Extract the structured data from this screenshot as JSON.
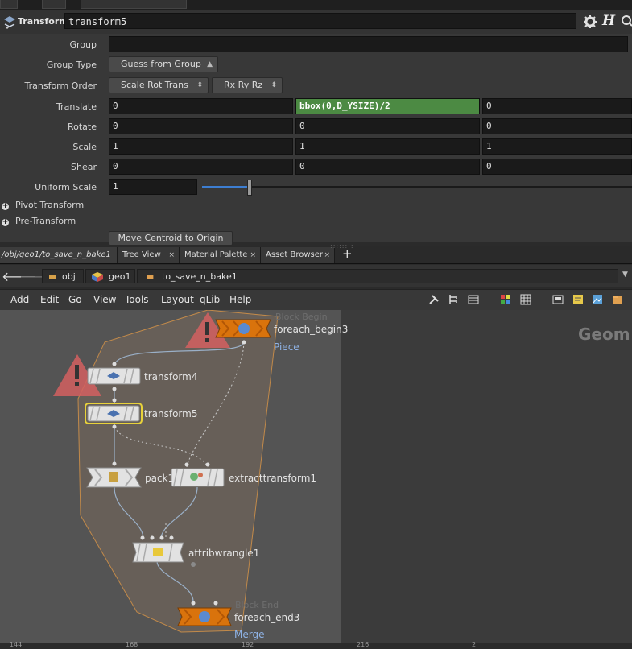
{
  "param_header": {
    "node_type": "Transform",
    "node_name": "transform5"
  },
  "params": {
    "group": {
      "label": "Group",
      "value": ""
    },
    "group_type": {
      "label": "Group Type",
      "value": "Guess from Group"
    },
    "transform_order": {
      "label": "Transform Order",
      "value": "Scale Rot Trans",
      "rot_value": "Rx Ry Rz"
    },
    "translate": {
      "label": "Translate",
      "x": "0",
      "y": "bbox(0,D_YSIZE)/2",
      "z": "0"
    },
    "rotate": {
      "label": "Rotate",
      "x": "0",
      "y": "0",
      "z": "0"
    },
    "scale": {
      "label": "Scale",
      "x": "1",
      "y": "1",
      "z": "1"
    },
    "shear": {
      "label": "Shear",
      "x": "0",
      "y": "0",
      "z": "0"
    },
    "uniform_scale": {
      "label": "Uniform Scale",
      "value": "1",
      "slider_fraction": 0.11
    },
    "pivot_transform": {
      "label": "Pivot Transform"
    },
    "pre_transform": {
      "label": "Pre-Transform"
    },
    "move_centroid": {
      "label": "Move Centroid to Origin"
    }
  },
  "tabs": [
    {
      "label": "/obj/geo1/to_save_n_bake1"
    },
    {
      "label": "Tree View"
    },
    {
      "label": "Material Palette"
    },
    {
      "label": "Asset Browser"
    }
  ],
  "breadcrumb": [
    "obj",
    "geo1",
    "to_save_n_bake1"
  ],
  "menu": [
    "Add",
    "Edit",
    "Go",
    "View",
    "Tools",
    "Layout",
    "qLib",
    "Help"
  ],
  "network": {
    "watermark": "Geom",
    "nodes": {
      "foreach_begin": {
        "label": "foreach_begin3",
        "sub": "Piece",
        "ghost": "Block Begin"
      },
      "transform4": {
        "label": "transform4"
      },
      "transform5": {
        "label": "transform5"
      },
      "pack": {
        "label": "pack1"
      },
      "extract": {
        "label": "extracttransform1"
      },
      "wrangle": {
        "label": "attribwrangle1"
      },
      "foreach_end": {
        "label": "foreach_end3",
        "sub": "Merge",
        "ghost": "Block End"
      }
    },
    "ruler": [
      "144",
      "168",
      "192",
      "216",
      "2"
    ]
  },
  "colors": {
    "expression_green": "#4c8a43",
    "foreach_orange": "#d9730c",
    "selected_outline": "#e8d23a",
    "warning_red": "#d46060",
    "block_fill": "#6b6159",
    "block_outline": "#c28a4a"
  }
}
